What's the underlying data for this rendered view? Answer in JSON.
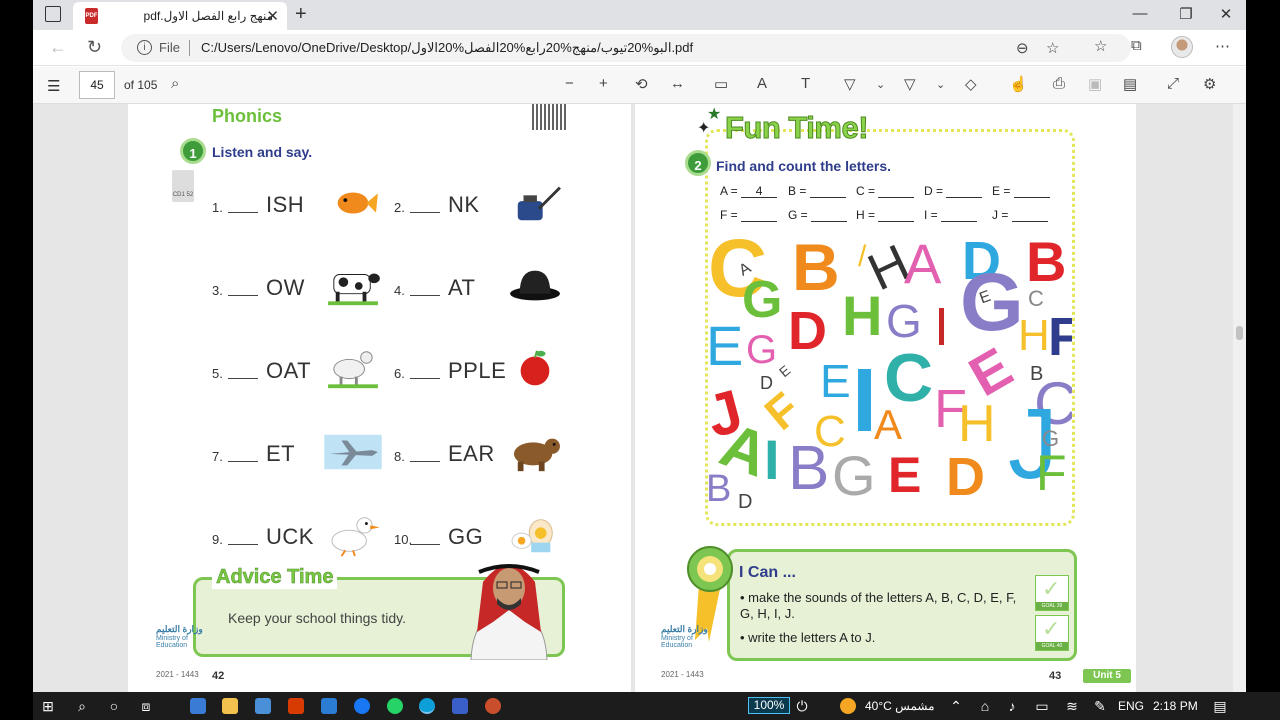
{
  "browser": {
    "tab_title": "منهج رابع الفصل الاول.pdf",
    "file_label": "File",
    "url": "C:/Users/Lenovo/OneDrive/Desktop/البو%20تيوب/منهج%20رابع%20الفصل%20الاول.pdf"
  },
  "pdf_toolbar": {
    "page_current": "45",
    "page_of": "of 105"
  },
  "left_page": {
    "section": "Phonics",
    "exercise_num": "1",
    "exercise_title": "Listen and say.",
    "cd_label": "CD1 52",
    "items": [
      {
        "num": "1.",
        "word": "ISH",
        "picture": "fish"
      },
      {
        "num": "2.",
        "word": "NK",
        "picture": "ink"
      },
      {
        "num": "3.",
        "word": "OW",
        "picture": "cow"
      },
      {
        "num": "4.",
        "word": "AT",
        "picture": "hat"
      },
      {
        "num": "5.",
        "word": "OAT",
        "picture": "goat"
      },
      {
        "num": "6.",
        "word": "PPLE",
        "picture": "apple"
      },
      {
        "num": "7.",
        "word": "ET",
        "picture": "jet"
      },
      {
        "num": "8.",
        "word": "EAR",
        "picture": "bear"
      },
      {
        "num": "9.",
        "word": "UCK",
        "picture": "duck"
      },
      {
        "num": "10.",
        "word": "GG",
        "picture": "egg"
      }
    ],
    "advice_title": "Advice Time",
    "advice_text": "Keep your school things tidy.",
    "ministry": "وزارة التعليم",
    "ministry_en": "Ministry of Education",
    "year": "2021 - 1443",
    "page_number": "42"
  },
  "right_page": {
    "title": "Fun Time!",
    "exercise_num": "2",
    "exercise_title": "Find and count the letters.",
    "counts": [
      {
        "letter": "A =",
        "value": "4"
      },
      {
        "letter": "B =",
        "value": ""
      },
      {
        "letter": "C =",
        "value": ""
      },
      {
        "letter": "D =",
        "value": ""
      },
      {
        "letter": "E =",
        "value": ""
      },
      {
        "letter": "F =",
        "value": ""
      },
      {
        "letter": "G =",
        "value": ""
      },
      {
        "letter": "H =",
        "value": ""
      },
      {
        "letter": "I =",
        "value": ""
      },
      {
        "letter": "J =",
        "value": ""
      }
    ],
    "ican_title": "I Can ...",
    "ican_items": [
      "make the sounds of the letters A, B, C, D, E, F, G, H, I, J.",
      "write the letters A to J."
    ],
    "goals": [
      "GOAL 39",
      "GOAL 40"
    ],
    "ministry": "وزارة التعليم",
    "ministry_en": "Ministry of Education",
    "year": "2021 - 1443",
    "page_number": "43",
    "unit": "Unit 5"
  },
  "taskbar": {
    "battery": "100%",
    "weather": "40°C مشمس",
    "language": "ENG",
    "time": "2:18 PM"
  },
  "colors": {
    "accent_green": "#7cc651",
    "title_blue": "#2f3d8c",
    "taskbar": "#1c1c1c"
  }
}
